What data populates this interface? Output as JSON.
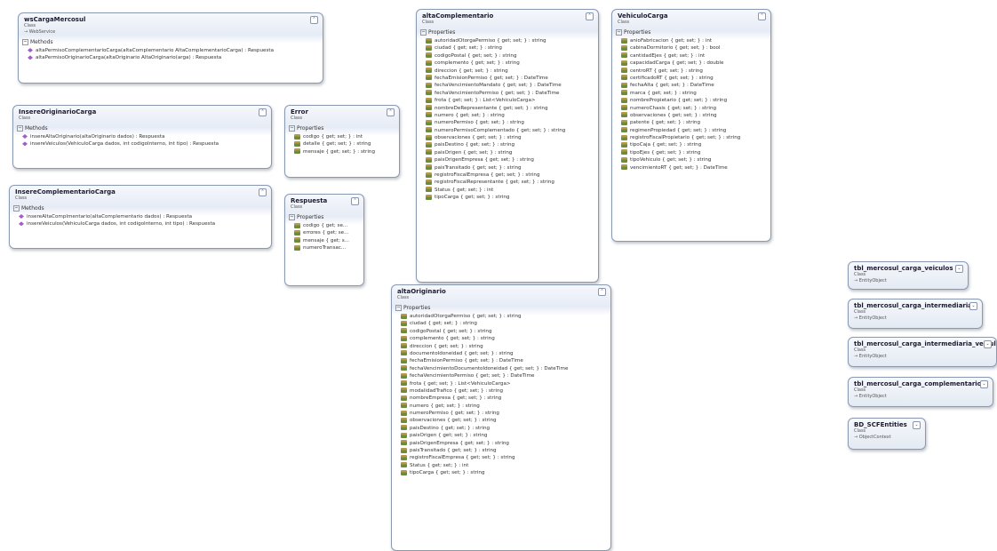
{
  "classes": {
    "wsCargaMercosul": {
      "name": "wsCargaMercosul",
      "stereotype": "Class",
      "base": "→ WebService",
      "section": "Methods",
      "members": [
        "altaPermisoComplementarioCarga(altaComplementario AltaComplementarioCarga) : Respuesta",
        "altaPermisoOriginarioCarga(altaOriginario AltaOriginario(arga) : Respuesta"
      ]
    },
    "insereOriginarioCarga": {
      "name": "InsereOriginarioCarga",
      "stereotype": "Class",
      "section": "Methods",
      "members": [
        "insereAltaOriginario(altaOriginario dados) : Respuesta",
        "insereVeiculos(VehiculoCarga dados, int codigoInterno, int tipo) : Respuesta"
      ]
    },
    "insereComplementarioCarga": {
      "name": "InsereComplementarioCarga",
      "stereotype": "Class",
      "section": "Methods",
      "members": [
        "insereAltaComplmentario(altaComplementario dados) : Respuesta",
        "insereVeiculos(VehiculoCarga dados, int codigoInterno, int tipo) : Respuesta"
      ]
    },
    "error": {
      "name": "Error",
      "stereotype": "Class",
      "section": "Properties",
      "members": [
        "codigo { get; set; } : int",
        "detalle { get; set; } : string",
        "mensaje { get; set; } : string"
      ]
    },
    "respuesta": {
      "name": "Respuesta",
      "stereotype": "Class",
      "section": "Properties",
      "members": [
        "codigo { get; se...",
        "errores { get; se...",
        "mensaje { get; s...",
        "numeroTransac..."
      ]
    },
    "altaComplementario": {
      "name": "altaComplementario",
      "stereotype": "Class",
      "section": "Properties",
      "members": [
        "autoridadOtorgaPermiso { get; set; } : string",
        "ciudad { get; set; } : string",
        "codigoPostal { get; set; } : string",
        "complemento { get; set; } : string",
        "direccion { get; set; } : string",
        "fechaEmisionPermiso { get; set; } : DateTime",
        "fechaVencimientoMandato { get; set; } : DateTime",
        "fechaVencimientoPermiso { get; set; } : DateTime",
        "frota { get; set; } : List<VehiculoCarga>",
        "nombreDeRepresentante { get; set; } : string",
        "numero { get; set; } : string",
        "numeroPermiso { get; set; } : string",
        "numeroPermisoComplementado { get; set; } : string",
        "observaciones { get; set; } : string",
        "paisDestino { get; set; } : string",
        "paisOrigen { get; set; } : string",
        "paisOrigenEmpresa { get; set; } : string",
        "paisTransitado { get; set; } : string",
        "registroFiscalEmpresa { get; set; } : string",
        "registroFiscalRepresentante { get; set; } : string",
        "Status { get; set; } : int",
        "tipoCarga { get; set; } : string"
      ]
    },
    "vehiculoCarga": {
      "name": "VehiculoCarga",
      "stereotype": "Class",
      "section": "Properties",
      "members": [
        "anioFabricacion { get; set; } : int",
        "cabinaDormitorio { get; set; } : bool",
        "cantidadEjes { get; set; } : int",
        "capacidadCarga { get; set; } : double",
        "centroRT { get; set; } : string",
        "certificadoRT { get; set; } : string",
        "fechaAlta { get; set; } : DateTime",
        "marca { get; set; } : string",
        "nombrePropietario { get; set; } : string",
        "numeroChasis { get; set; } : string",
        "observaciones { get; set; } : string",
        "patente { get; set; } : string",
        "regimenPropiedad { get; set; } : string",
        "registroFiscalPropietario { get; set; } : string",
        "tipoCaja { get; set; } : string",
        "tipoEjes { get; set; } : string",
        "tipoVehiculo { get; set; } : string",
        "vencimientoRT { get; set; } : DateTime"
      ]
    },
    "altaOriginario": {
      "name": "altaOriginario",
      "stereotype": "Class",
      "section": "Properties",
      "members": [
        "autoridadOtorgaPermiso { get; set; } : string",
        "ciudad { get; set; } : string",
        "codigoPostal { get; set; } : string",
        "complemento { get; set; } : string",
        "direccion { get; set; } : string",
        "documentoIdoneidad { get; set; } : string",
        "fechaEmisionPermiso { get; set; } : DateTime",
        "fechaVencimientoDocumentoIdoneidad { get; set; } : DateTime",
        "fechaVencimientoPermiso { get; set; } : DateTime",
        "frota { get; set; } : List<VehiculoCarga>",
        "modalidadTrafico { get; set; } : string",
        "nombreEmpresa { get; set; } : string",
        "numero { get; set; } : string",
        "numeroPermiso { get; set; } : string",
        "observaciones { get; set; } : string",
        "paisDestino { get; set; } : string",
        "paisOrigen { get; set; } : string",
        "paisOrigenEmpresa { get; set; } : string",
        "paisTransitado { get; set; } : string",
        "registroFiscalEmpresa { get; set; } : string",
        "Status { get; set; } : int",
        "tipoCarga { get; set; } : string"
      ]
    },
    "tblVeiculos": {
      "name": "tbl_mercosul_carga_veiculos",
      "stereotype": "Class",
      "base": "→ EntityObject"
    },
    "tblIntermediaria": {
      "name": "tbl_mercosul_carga_intermediaria",
      "stereotype": "Class",
      "base": "→ EntityObject"
    },
    "tblIntermediariaVeiculo": {
      "name": "tbl_mercosul_carga_intermediaria_veiculo",
      "stereotype": "Class",
      "base": "→ EntityObject"
    },
    "tblComplementario": {
      "name": "tbl_mercosul_carga_complementario",
      "stereotype": "Class",
      "base": "→ EntityObject"
    },
    "bdEntities": {
      "name": "BD_SCFEntities",
      "stereotype": "Class",
      "base": "→ ObjectContext"
    }
  }
}
